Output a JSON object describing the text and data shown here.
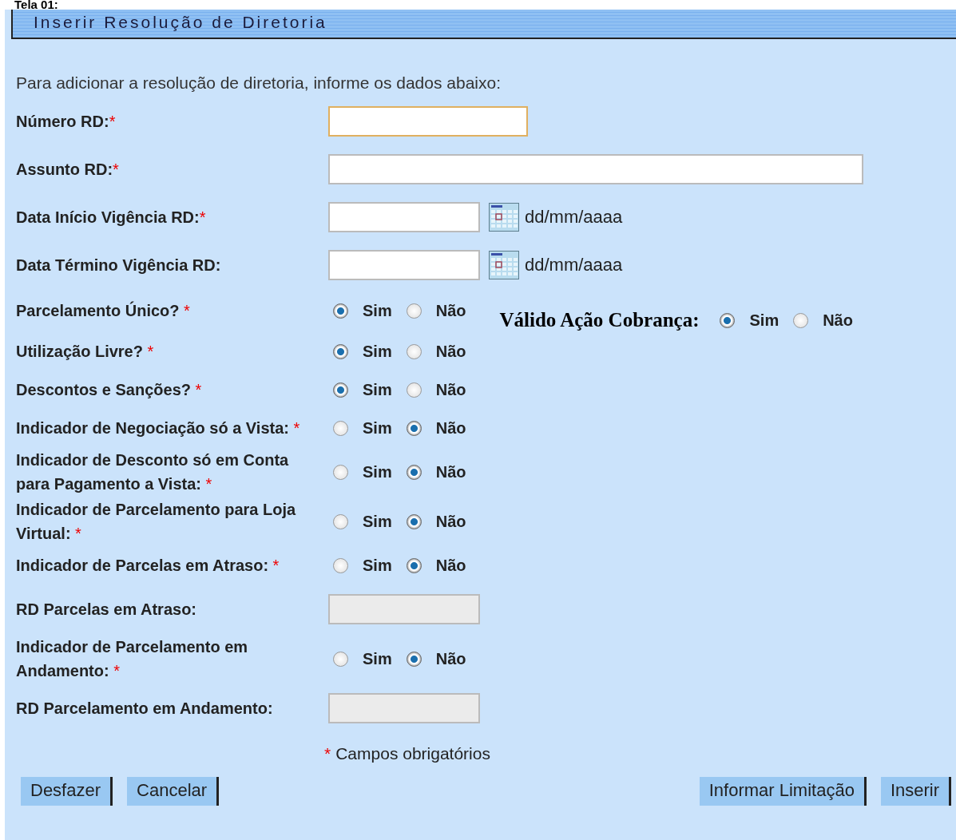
{
  "page_heading": "Tela 01:",
  "window": {
    "title": "Inserir Resolução de Diretoria"
  },
  "intro": "Para adicionar a resolução de diretoria, informe os dados abaixo:",
  "fields": [
    {
      "kind": "shorttext",
      "label": "Número RD:",
      "mark": "*",
      "focused": true
    },
    {
      "kind": "longtext",
      "label": "Assunto RD:",
      "mark": "*",
      "focused": false
    },
    {
      "kind": "date",
      "label": "Data Início Vigência RD:",
      "mark": "*",
      "hint": "dd/mm/aaaa"
    },
    {
      "kind": "date",
      "label": "Data Término Vigência RD:",
      "hint": "dd/mm/aaaa"
    },
    {
      "kind": "radio",
      "label": "Parcelamento Único? ",
      "mark": "*",
      "options": [
        {
          "label": "Sim",
          "selected": true
        },
        {
          "label": "Não",
          "selected": false
        }
      ],
      "side": {
        "label": "Válido Ação Cobrança:",
        "options": [
          {
            "label": "Sim",
            "selected": true
          },
          {
            "label": "Não",
            "selected": false
          }
        ]
      }
    },
    {
      "kind": "radio",
      "label": "Utilização Livre? ",
      "mark": "*",
      "options": [
        {
          "label": "Sim",
          "selected": true
        },
        {
          "label": "Não",
          "selected": false
        }
      ]
    },
    {
      "kind": "radio",
      "label": "Descontos e Sanções? ",
      "mark": "*",
      "options": [
        {
          "label": "Sim",
          "selected": true
        },
        {
          "label": "Não",
          "selected": false
        }
      ]
    },
    {
      "kind": "radio",
      "label": "Indicador de Negociação só a Vista: ",
      "mark": "*",
      "options": [
        {
          "label": "Sim",
          "selected": false
        },
        {
          "label": "Não",
          "selected": true
        }
      ]
    },
    {
      "kind": "radio",
      "label": "Indicador de Desconto só em Conta para Pagamento a Vista: ",
      "mark": "*",
      "options": [
        {
          "label": "Sim",
          "selected": false
        },
        {
          "label": "Não",
          "selected": true
        }
      ]
    },
    {
      "kind": "radio",
      "label": "Indicador de Parcelamento para Loja Virtual: ",
      "mark": "*",
      "options": [
        {
          "label": "Sim",
          "selected": false
        },
        {
          "label": "Não",
          "selected": true
        }
      ]
    },
    {
      "kind": "radio",
      "label": "Indicador de Parcelas em Atraso: ",
      "mark": "*",
      "options": [
        {
          "label": "Sim",
          "selected": false
        },
        {
          "label": "Não",
          "selected": true
        }
      ]
    },
    {
      "kind": "readonly",
      "label": "RD Parcelas em Atraso:"
    },
    {
      "kind": "radio",
      "label": "Indicador de Parcelamento em Andamento: ",
      "mark": "*",
      "options": [
        {
          "label": "Sim",
          "selected": false
        },
        {
          "label": "Não",
          "selected": true
        }
      ]
    },
    {
      "kind": "readonly",
      "label": "RD Parcelamento em Andamento:"
    }
  ],
  "required_note": {
    "mark": "*",
    "text": "Campos obrigatórios"
  },
  "buttons_left": [
    "Desfazer",
    "Cancelar"
  ],
  "buttons_right": [
    "Informar Limitação",
    "Inserir"
  ]
}
